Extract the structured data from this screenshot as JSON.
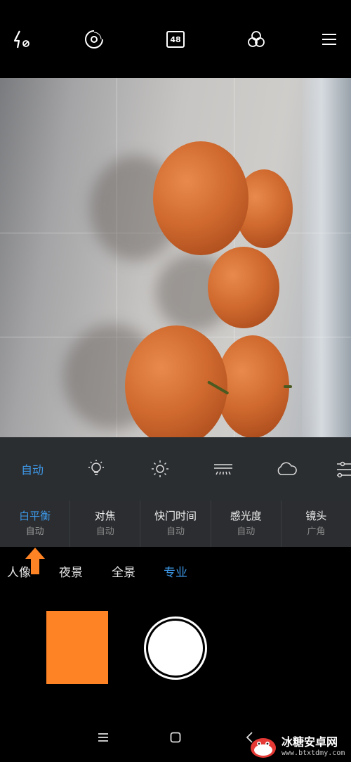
{
  "topbar": {
    "flash_icon": "flash-off-icon",
    "hdr_icon": "hdr-ring-icon",
    "megapixel_label": "48",
    "filter_icon": "filters-icon",
    "menu_icon": "hamburger-menu-icon"
  },
  "white_balance_presets": {
    "auto_label": "自动",
    "icons": [
      "incandescent-bulb-icon",
      "sunny-icon",
      "fluorescent-icon",
      "cloudy-icon",
      "custom-sliders-icon"
    ]
  },
  "params": [
    {
      "label": "白平衡",
      "value": "自动"
    },
    {
      "label": "对焦",
      "value": "自动"
    },
    {
      "label": "快门时间",
      "value": "自动"
    },
    {
      "label": "感光度",
      "value": "自动"
    },
    {
      "label": "镜头",
      "value": "广角"
    }
  ],
  "modes": [
    "人像",
    "夜景",
    "全景",
    "专业"
  ],
  "active_mode": "专业",
  "colors": {
    "accent": "#3d97e6",
    "thumbnail": "#fe8324",
    "annotation_arrow": "#fe8324"
  },
  "navbar": {
    "icons": [
      "recent-apps-icon",
      "home-icon",
      "back-icon"
    ]
  },
  "watermark": {
    "title": "冰糖安卓网",
    "url": "www.btxtdmy.com"
  }
}
